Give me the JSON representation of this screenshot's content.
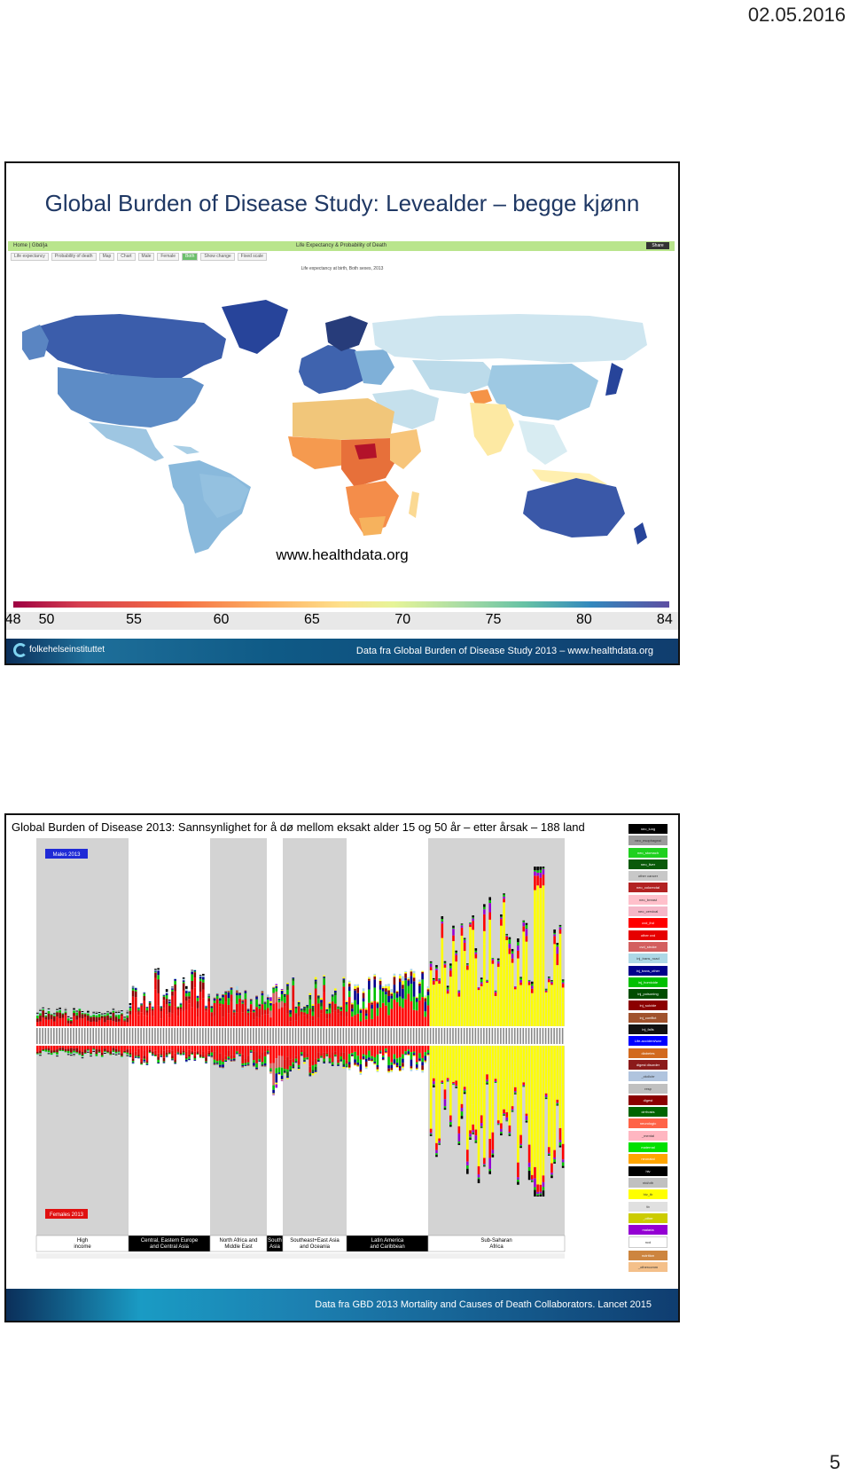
{
  "page": {
    "date": "02.05.2016",
    "number": "5"
  },
  "slide1": {
    "title": "Global Burden of Disease Study: Levealder – begge kjønn",
    "app_nav": "Home  |  Gbd/ja",
    "app_title": "Life Expectancy & Probability of Death",
    "share_label": "Share",
    "app_tools": [
      "Life expectancy",
      "Probability of death",
      "Map",
      "Chart",
      "Male",
      "Female",
      "Both",
      "Show change",
      "Fixed scale"
    ],
    "active_tool": "Both",
    "map_subtitle": "Life expectancy at birth, Both sexes, 2013",
    "url": "www.healthdata.org",
    "legend_ticks": [
      "48",
      "50",
      "55",
      "60",
      "65",
      "70",
      "75",
      "80",
      "84"
    ],
    "logo": "folkehelseinstituttet",
    "source": "Data fra Global Burden of Disease Study 2013 – www.healthdata.org"
  },
  "slide2": {
    "title": "Global Burden of Disease 2013: Sannsynlighet for å dø mellom eksakt alder 15 og 50 år – etter årsak – 188 land",
    "males_label": "Males 2013",
    "females_label": "Females 2013",
    "regions": [
      {
        "label": "High\nincome",
        "dark": false
      },
      {
        "label": "Central, Eastern Europe\nand Central Asia",
        "dark": true
      },
      {
        "label": "North Africa and\nMiddle East",
        "dark": false
      },
      {
        "label": "South\nAsia",
        "dark": true
      },
      {
        "label": "Southeast+East Asia\nand Oceania",
        "dark": false
      },
      {
        "label": "Latin America\nand Caribbean",
        "dark": true
      },
      {
        "label": "Sub-Saharan\nAfrica",
        "dark": false
      }
    ],
    "cause_key": [
      {
        "name": "neo_lung",
        "color": "#000000"
      },
      {
        "name": "neo_esophageal",
        "color": "#9a9a9a"
      },
      {
        "name": "neo_stomach",
        "color": "#1fd11f"
      },
      {
        "name": "neo_liver",
        "color": "#0a5a0a"
      },
      {
        "name": "other cancer",
        "color": "#c8c8c8"
      },
      {
        "name": "neo_colorectal",
        "color": "#b22222"
      },
      {
        "name": "neo_breast",
        "color": "#ffc0cb"
      },
      {
        "name": "neo_cervical",
        "color": "#f5b7c8"
      },
      {
        "name": "cvd_ihd",
        "color": "#ff0000"
      },
      {
        "name": "other cvd",
        "color": "#e60000"
      },
      {
        "name": "cvd_stroke",
        "color": "#d35f5f"
      },
      {
        "name": "inj_trans_road",
        "color": "#add8e6"
      },
      {
        "name": "inj_trans_other",
        "color": "#00008b"
      },
      {
        "name": "inj_homicide",
        "color": "#00c000"
      },
      {
        "name": "inj_poisoning",
        "color": "#004d00"
      },
      {
        "name": "inj_suicide",
        "color": "#8b0000"
      },
      {
        "name": "inj_conflict",
        "color": "#a0522d"
      },
      {
        "name": "inj_falls",
        "color": "#111111"
      },
      {
        "name": "Life-accident/war",
        "color": "#0000ff"
      },
      {
        "name": "diabetes",
        "color": "#d2691e"
      },
      {
        "name": "digest disorder",
        "color": "#8b1a1a"
      },
      {
        "name": "_ckd/cirr",
        "color": "#b0c4de"
      },
      {
        "name": "resp",
        "color": "#c0c0c0"
      },
      {
        "name": "digest",
        "color": "#8b0000"
      },
      {
        "name": "cirrhosis",
        "color": "#006400"
      },
      {
        "name": "neurologic",
        "color": "#ff6347"
      },
      {
        "name": "_mental",
        "color": "#ffb6c1"
      },
      {
        "name": "maternal",
        "color": "#00e000"
      },
      {
        "name": "neonatal",
        "color": "#ffa500"
      },
      {
        "name": "hiv",
        "color": "#000000"
      },
      {
        "name": "ntd/oth",
        "color": "#c0c0c0"
      },
      {
        "name": "hiv_tb",
        "color": "#ffff00"
      },
      {
        "name": "tb",
        "color": "#e0e0e0"
      },
      {
        "name": "_other",
        "color": "#cccc00"
      },
      {
        "name": "malaria",
        "color": "#9400d3"
      },
      {
        "name": "ncd",
        "color": "#ffffff"
      },
      {
        "name": "nutrition",
        "color": "#cd853f"
      },
      {
        "name": "_othercomm",
        "color": "#f4c08a"
      }
    ],
    "source": "Data fra GBD 2013 Mortality and Causes of Death Collaborators. Lancet 2015"
  }
}
